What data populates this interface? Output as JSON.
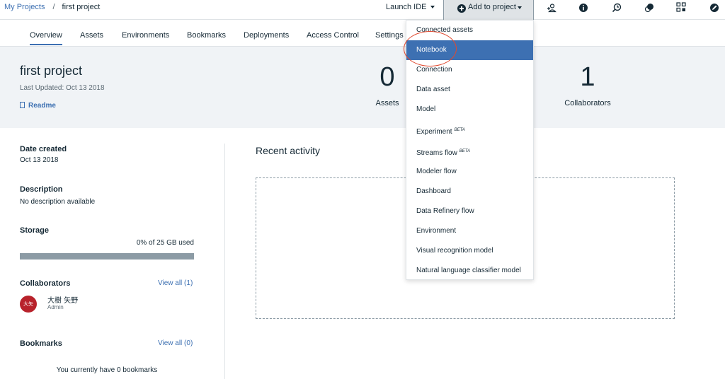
{
  "breadcrumb": {
    "root": "My Projects",
    "separator": "/",
    "current": "first project"
  },
  "topbar": {
    "launch_ide": "Launch IDE",
    "add_to_project": "Add to project",
    "icons": [
      "add-collaborator-icon",
      "info-icon",
      "history-icon",
      "comments-icon",
      "data-flow-icon",
      "edit-icon"
    ]
  },
  "tabs": [
    "Overview",
    "Assets",
    "Environments",
    "Bookmarks",
    "Deployments",
    "Access Control",
    "Settings"
  ],
  "active_tab": "Overview",
  "project": {
    "title": "first project",
    "last_updated": "Last Updated: Oct 13 2018",
    "readme": "Readme",
    "assets_count": "0",
    "assets_label": "Assets",
    "collaborators_count": "1",
    "collaborators_label": "Collaborators"
  },
  "details": {
    "date_created_label": "Date created",
    "date_created": "Oct 13 2018",
    "description_label": "Description",
    "description": "No description available",
    "storage_label": "Storage",
    "storage_used": "0% of 25 GB used",
    "storage_fraction": 0,
    "collaborators_label": "Collaborators",
    "collaborators_view_all": "View all (1)",
    "collaborator_initials": "大矢",
    "collaborator_name": "大樹 矢野",
    "collaborator_role": "Admin",
    "bookmarks_label": "Bookmarks",
    "bookmarks_view_all": "View all (0)",
    "bookmarks_empty": "You currently have 0 bookmarks"
  },
  "recent": {
    "title": "Recent activity"
  },
  "menu": {
    "items": [
      {
        "label": "Connected assets",
        "badge": ""
      },
      {
        "label": "Notebook",
        "badge": ""
      },
      {
        "label": "Connection",
        "badge": ""
      },
      {
        "label": "Data asset",
        "badge": ""
      },
      {
        "label": "Model",
        "badge": ""
      },
      {
        "label": "Experiment",
        "badge": "BETA"
      },
      {
        "label": "Streams flow",
        "badge": "BETA"
      },
      {
        "label": "Modeler flow",
        "badge": ""
      },
      {
        "label": "Dashboard",
        "badge": ""
      },
      {
        "label": "Data Refinery flow",
        "badge": ""
      },
      {
        "label": "Environment",
        "badge": ""
      },
      {
        "label": "Visual recognition model",
        "badge": ""
      },
      {
        "label": "Natural language classifier model",
        "badge": ""
      }
    ],
    "highlighted": "Notebook"
  },
  "colors": {
    "accent": "#3d70b2",
    "annotation": "#e0492f",
    "avatar": "#b8222b"
  }
}
